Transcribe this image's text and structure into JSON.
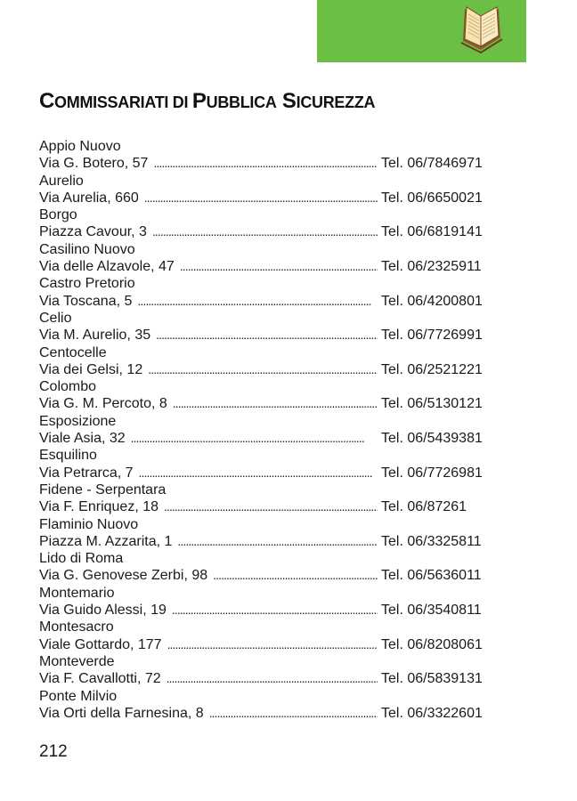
{
  "header": {
    "tab_color": "#6cbf45",
    "icon": "open-book-icon"
  },
  "title": {
    "parts": [
      {
        "cap": "C",
        "rest": "OMMISSARIATI"
      },
      {
        "cap": "",
        "rest": " DI "
      },
      {
        "cap": "P",
        "rest": "UBBLICA"
      },
      {
        "cap": " S",
        "rest": "ICUREZZA"
      }
    ],
    "text": "Commissariati di Pubblica Sicurezza"
  },
  "entries": [
    {
      "district": "Appio Nuovo",
      "address": "Via G. Botero, 57",
      "tel": "Tel. 06/7846971"
    },
    {
      "district": "Aurelio",
      "address": "Via Aurelia, 660",
      "tel": "Tel. 06/6650021"
    },
    {
      "district": "Borgo",
      "address": "Piazza Cavour, 3",
      "tel": "Tel. 06/6819141"
    },
    {
      "district": "Casilino Nuovo",
      "address": "Via delle Alzavole, 47",
      "tel": "Tel. 06/2325911"
    },
    {
      "district": "Castro Pretorio",
      "address": "Via Toscana, 5",
      "tel": "Tel. 06/4200801"
    },
    {
      "district": "Celio",
      "address": "Via M. Aurelio, 35",
      "tel": "Tel. 06/7726991"
    },
    {
      "district": "Centocelle",
      "address": "Via dei Gelsi, 12",
      "tel": "Tel. 06/2521221"
    },
    {
      "district": "Colombo",
      "address": "Via G. M. Percoto, 8",
      "tel": "Tel. 06/5130121"
    },
    {
      "district": "Esposizione",
      "address": "Viale Asia, 32",
      "tel": "Tel. 06/5439381"
    },
    {
      "district": "Esquilino",
      "address": "Via Petrarca, 7",
      "tel": "Tel. 06/7726981"
    },
    {
      "district": "Fidene - Serpentara",
      "address": "Via F. Enriquez, 18",
      "tel": "Tel. 06/87261"
    },
    {
      "district": "Flaminio Nuovo",
      "address": "Piazza M. Azzarita, 1",
      "tel": "Tel. 06/3325811"
    },
    {
      "district": "Lido di Roma",
      "address": "Via G. Genovese Zerbi, 98",
      "tel": "Tel. 06/5636011"
    },
    {
      "district": "Montemario",
      "address": "Via Guido Alessi, 19",
      "tel": "Tel. 06/3540811"
    },
    {
      "district": "Montesacro",
      "address": "Viale Gottardo, 177",
      "tel": "Tel. 06/8208061"
    },
    {
      "district": "Monteverde",
      "address": "Via F. Cavallotti, 72",
      "tel": "Tel. 06/5839131"
    },
    {
      "district": "Ponte Milvio",
      "address": "Via Orti della Farnesina, 8",
      "tel": "Tel. 06/3322601"
    }
  ],
  "page_number": "212"
}
